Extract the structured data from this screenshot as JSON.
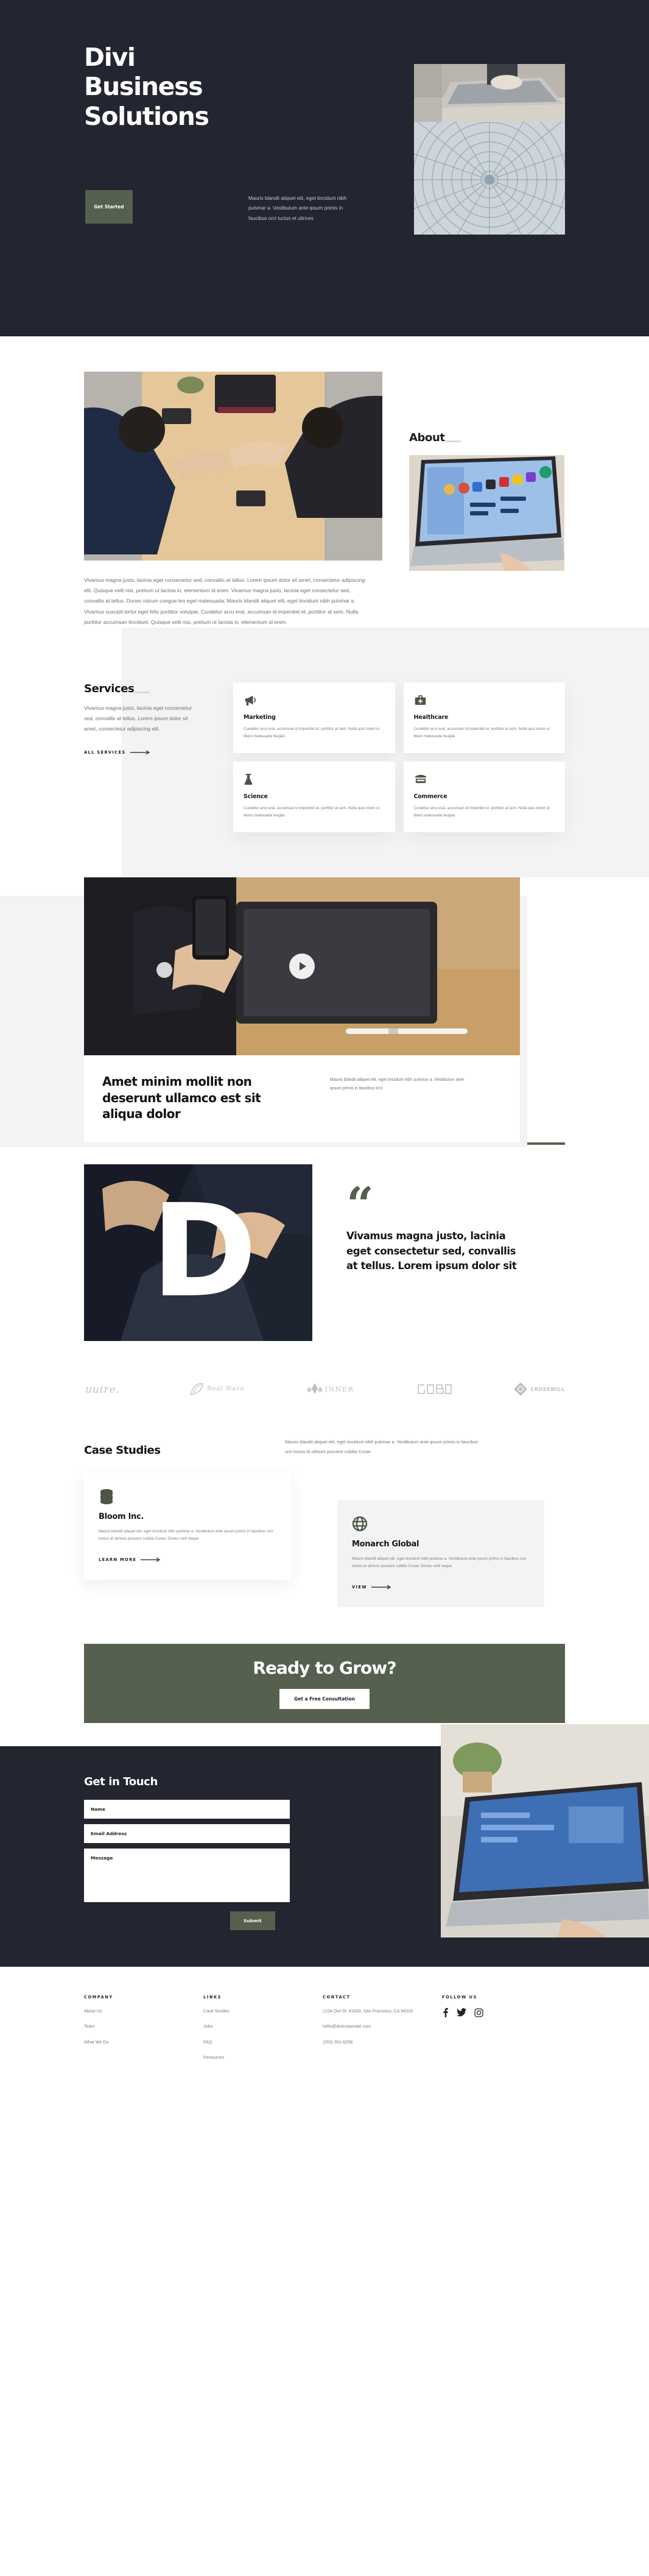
{
  "hero": {
    "title_lines": [
      "Divi",
      "Business",
      "Solutions"
    ],
    "button_label": "Get Started",
    "paragraph": "Mauris blandit aliquet elit, eget tincidunt nibh pulvinar a. Vestibulum ante ipsum primis in faucibus orci luctus et ultrices",
    "bg_color": "#232530",
    "accent_color": "#55604e",
    "image_top": "laptop-typing-photo",
    "image_bottom": "circular-pavement-photo"
  },
  "about": {
    "photo": "handshake-over-desk-photo",
    "paragraph": "Vivamus magna justo, lacinia eget consectetur sed, convallis at tellus. Lorem ipsum dolor sit amet, consectetur adipiscing elit. Quisque velit nisi, pretium ut lacinia in, elementum id enim. Vivamus magna justo, lacinia eget consectetur sed, convallis at tellus. Donec rutrum congue leo eget malesuada. Mauris blandit aliquet elit, eget tincidunt nibh pulvinar a. Vivamus suscipit tortor eget felis porttitor volutpat. Curabitur arcu erat, accumsan id imperdiet et, porttitor at sem. Nulla porttitor accumsan tincidunt. Quisque velit nisi, pretium ut lacinia in, elementum id enim.",
    "heading": "About",
    "side_photo": "laptop-screen-apps-photo"
  },
  "services": {
    "heading": "Services",
    "paragraph": "Vivamus magna justo, lacinia eget consectetur sed, convallis at tellus. Lorem ipsum dolor sit amet, consectetur adipiscing elit.",
    "link_label": "ALL SERVICES",
    "card_body": "Curabitur arcu erat, accumsan id imperdiet et, porttitor at sem. Nulla quis lorem ut libero malesuada feugiat.",
    "cards": [
      {
        "title": "Marketing",
        "icon": "megaphone-icon"
      },
      {
        "title": "Healthcare",
        "icon": "first-aid-kit-icon"
      },
      {
        "title": "Science",
        "icon": "flask-icon"
      },
      {
        "title": "Commerce",
        "icon": "storefront-icon"
      }
    ]
  },
  "feature": {
    "media": "hands-phone-tablet-photo",
    "play_icon": "play-icon",
    "title": "Amet minim mollit non deserunt ullamco est sit aliqua dolor",
    "paragraph": "Mauris blandit aliquet elit, eget tincidunt nibh pulvinar a. Vestibulum ante ipsum primis in faucibus orci"
  },
  "testimonial": {
    "photo": "suit-letter-d-photo",
    "monogram": "D",
    "quote_mark": "“",
    "quote": "Vivamus magna justo, lacinia eget consectetur sed, convallis at tellus. Lorem ipsum dolor sit"
  },
  "logos": [
    {
      "name": "wire-logo",
      "label": "uuire"
    },
    {
      "name": "real-wave-logo",
      "label": "Real Wave"
    },
    {
      "name": "inner-logo",
      "label": "INNER"
    },
    {
      "name": "gabo-logo",
      "label": "GABO"
    },
    {
      "name": "crosswill-logo",
      "label": "CROSSWILL"
    }
  ],
  "cases": {
    "heading": "Case Studies",
    "paragraph": "Mauris blandit aliquet elit, eget tincidunt nibh pulvinar a. Vestibulum ante ipsum primis in faucibus orci luctus et ultrices posuere cubilia Curae",
    "items": [
      {
        "title": "Bloom Inc.",
        "icon": "database-icon",
        "body": "Mauris blandit aliquet elit, eget tincidunt nibh pulvinar a. Vestibulum ante ipsum primis in faucibus orci luctus et ultrices posuere cubilia Curae; Donec velit neque",
        "link_label": "LEARN MORE"
      },
      {
        "title": "Monarch Global",
        "icon": "globe-icon",
        "body": "Mauris blandit aliquet elit, eget tincidunt nibh pulvinar a. Vestibulum ante ipsum primis in faucibus orci luctus et ultrices posuere cubilia Curae; Donec velit neque",
        "link_label": "VIEW"
      }
    ]
  },
  "cta": {
    "heading": "Ready to Grow?",
    "button_label": "Get a Free Consultation",
    "bg_color": "#55604e"
  },
  "contact": {
    "heading": "Get in Touch",
    "name_placeholder": "Name",
    "email_placeholder": "Email Address",
    "message_placeholder": "Message",
    "submit_label": "Submit",
    "photo": "laptop-desk-plant-photo"
  },
  "footer": {
    "columns": [
      {
        "title": "COMPANY",
        "links": [
          "About Us",
          "Team",
          "What We Do"
        ]
      },
      {
        "title": "LINKS",
        "links": [
          "Case Studies",
          "Jobs",
          "FAQ",
          "Resources"
        ]
      }
    ],
    "contact": {
      "title": "CONTACT",
      "address": "1234 Divi St. #1000, San Francisco, CA 94220",
      "email": "hello@divicorporate.com",
      "phone": "(255) 352-6258"
    },
    "follow": {
      "title": "FOLLOW US",
      "icons": [
        "facebook-icon",
        "twitter-icon",
        "instagram-icon"
      ]
    }
  }
}
